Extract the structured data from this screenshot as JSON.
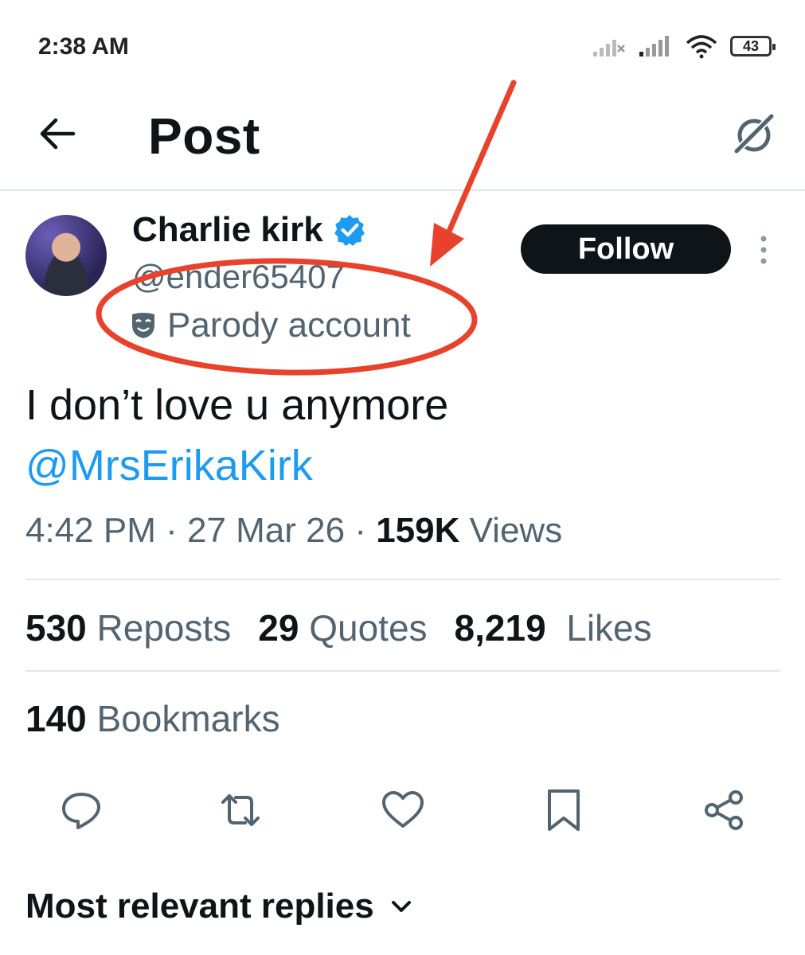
{
  "status_bar": {
    "time": "2:38 AM",
    "battery": "43"
  },
  "header": {
    "title": "Post"
  },
  "author": {
    "name": "Charlie kirk",
    "handle": "@ender65407",
    "label": "Parody account",
    "follow_label": "Follow"
  },
  "tweet": {
    "text": "I don’t love u anymore",
    "mention": "@MrsErikaKirk",
    "time": "4:42 PM",
    "date": "27 Mar 26",
    "views_count": "159K",
    "views_label": "Views"
  },
  "stats": {
    "reposts_count": "530",
    "reposts_label": "Reposts",
    "quotes_count": "29",
    "quotes_label": "Quotes",
    "likes_count": "8,219",
    "likes_label": "Likes",
    "bookmarks_count": "140",
    "bookmarks_label": "Bookmarks"
  },
  "replies": {
    "label": "Most relevant replies"
  },
  "colors": {
    "accent": "#1d9bf0",
    "annotation": "#e8412c",
    "text_secondary": "#536471"
  },
  "icons": [
    "back-arrow-icon",
    "grok-icon",
    "verified-badge-icon",
    "parody-mask-icon",
    "more-vert-icon",
    "reply-icon",
    "repost-icon",
    "like-icon",
    "bookmark-icon",
    "share-icon",
    "chevron-down-icon"
  ]
}
